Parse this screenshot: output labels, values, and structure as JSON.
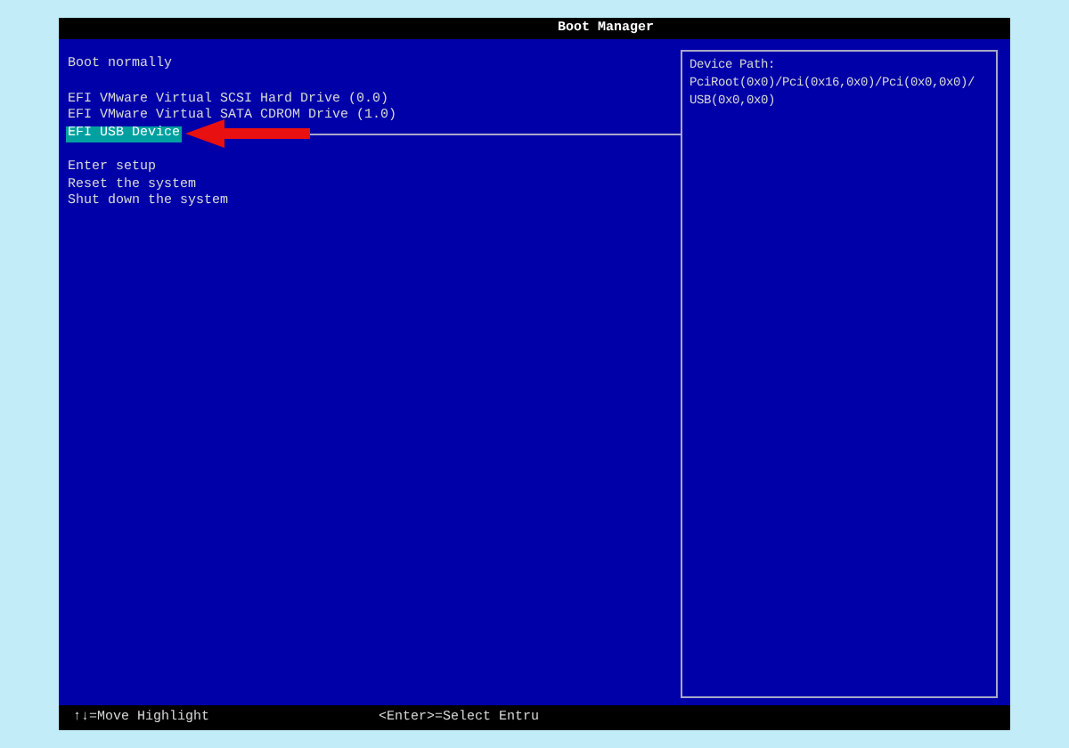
{
  "window": {
    "title": "Boot Manager"
  },
  "menu_groups": [
    [
      {
        "label": "Boot normally",
        "selected": false
      }
    ],
    [
      {
        "label": "EFI VMware Virtual SCSI Hard Drive (0.0)",
        "selected": false
      },
      {
        "label": "EFI VMware Virtual SATA CDROM Drive (1.0)",
        "selected": false
      },
      {
        "label": "EFI USB Device",
        "selected": true
      }
    ],
    [
      {
        "label": "Enter setup",
        "selected": false
      },
      {
        "label": "Reset the system",
        "selected": false
      },
      {
        "label": "Shut down the system",
        "selected": false
      }
    ]
  ],
  "details": {
    "heading": "Device Path:",
    "lines": [
      "PciRoot(0x0)/Pci(0x16,0x0)/Pci(0x0,0x0)/",
      "USB(0x0,0x0)"
    ]
  },
  "status_bar": [
    "↑↓=Move Highlight",
    "<Enter>=Select Entru"
  ]
}
